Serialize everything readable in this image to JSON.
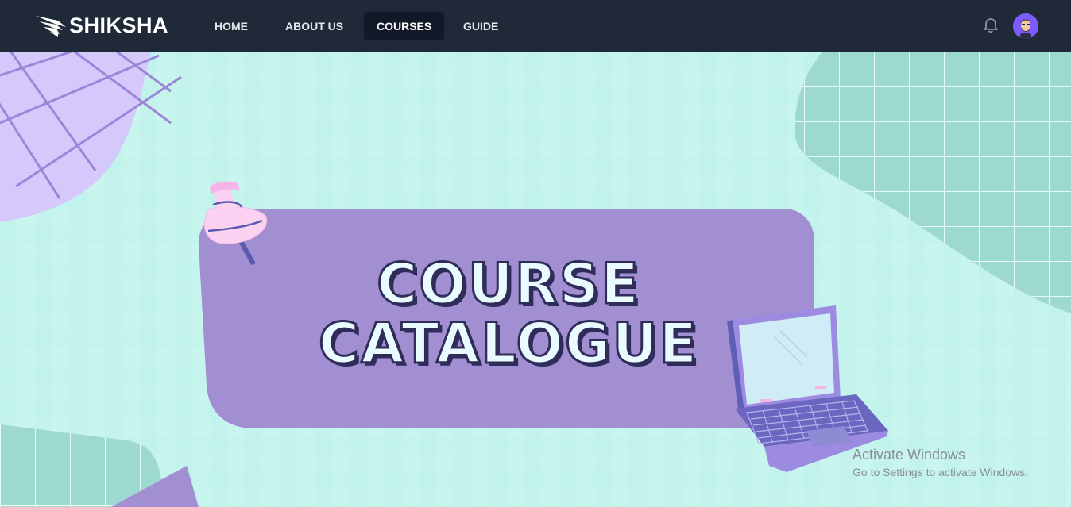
{
  "brand": {
    "name": "SHIKSHA",
    "logo_icon": "wing-logo-icon"
  },
  "nav": {
    "items": [
      {
        "label": "HOME",
        "active": false
      },
      {
        "label": "ABOUT US",
        "active": false
      },
      {
        "label": "COURSES",
        "active": true
      },
      {
        "label": "GUIDE",
        "active": false
      }
    ],
    "notification_icon": "bell-icon",
    "avatar_icon": "user-avatar-icon"
  },
  "hero": {
    "title_line1": "COURSE",
    "title_line2": "CATALOGUE",
    "decor": [
      "pushpin-icon",
      "laptop-icon"
    ]
  },
  "watermark": {
    "title": "Activate Windows",
    "subtitle": "Go to Settings to activate Windows."
  },
  "colors": {
    "navbar": "#1f2937",
    "hero_bg": "#c8f6ef",
    "banner": "#a18fd1",
    "title_fill": "#e9fbff",
    "title_outline": "#2f2c5a"
  }
}
